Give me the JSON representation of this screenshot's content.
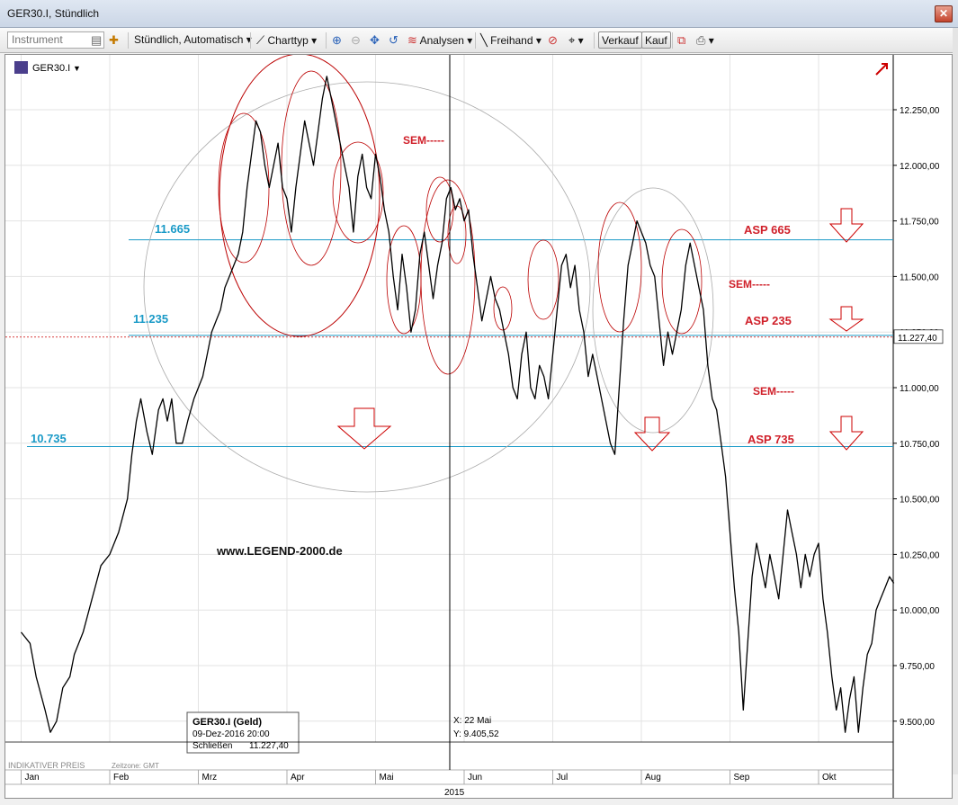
{
  "window": {
    "title": "GER30.I, Stündlich",
    "close_glyph": "✕"
  },
  "toolbar": {
    "instrument_placeholder": "Instrument",
    "timeframe": "Stündlich, Automatisch",
    "charttype": "Charttyp",
    "analysen": "Analysen",
    "freihand": "Freihand",
    "verkauf": "Verkauf",
    "kauf": "Kauf"
  },
  "chart_data": {
    "type": "line",
    "symbol": "GER30.I",
    "year_label": "2015",
    "months": [
      "Jan",
      "Feb",
      "Mrz",
      "Apr",
      "Mai",
      "Jun",
      "Jul",
      "Aug",
      "Sep",
      "Okt"
    ],
    "y_ticks": [
      9500,
      9750,
      10000,
      10250,
      10500,
      10750,
      11000,
      11250,
      11500,
      11750,
      12000,
      12250
    ],
    "y_tick_labels": [
      "9.500,00",
      "9.750,00",
      "10.000,00",
      "10.250,00",
      "10.500,00",
      "10.750,00",
      "11.000,00",
      "11.250,00",
      "11.500,00",
      "11.750,00",
      "12.000,00",
      "12.250,00"
    ],
    "ylim": [
      9340,
      12480
    ],
    "last_price": 11227.4,
    "last_price_label": "11.227,40",
    "crosshair": {
      "x_label": "X: 22 Mai",
      "y_label": "Y: 9.405,52"
    },
    "info_box": {
      "title": "GER30.I (Geld)",
      "date": "09-Dez-2016 20:00",
      "close_label": "Schließen",
      "close_value": "11.227,40"
    },
    "footer_left": "INDIKATIVER PREIS",
    "footer_tz": "Zeitzone: GMT",
    "levels": [
      {
        "value": 11665,
        "label": "11.665"
      },
      {
        "value": 11235,
        "label": "11.235"
      },
      {
        "value": 10735,
        "label": "10.735"
      }
    ],
    "annotations": {
      "watermark": "www.LEGEND-2000.de",
      "asp665": "ASP 665",
      "asp235": "ASP 235",
      "asp735": "ASP 735",
      "sem1": "SEM-----",
      "sem2": "SEM-----",
      "sem3": "SEM-----"
    },
    "series": [
      {
        "values": [
          [
            0.0,
            9900
          ],
          [
            0.1,
            9850
          ],
          [
            0.17,
            9700
          ],
          [
            0.27,
            9550
          ],
          [
            0.33,
            9450
          ],
          [
            0.4,
            9500
          ],
          [
            0.47,
            9650
          ],
          [
            0.55,
            9700
          ],
          [
            0.6,
            9800
          ],
          [
            0.7,
            9900
          ],
          [
            0.8,
            10050
          ],
          [
            0.9,
            10200
          ],
          [
            1.0,
            10250
          ],
          [
            1.1,
            10350
          ],
          [
            1.2,
            10500
          ],
          [
            1.25,
            10700
          ],
          [
            1.3,
            10850
          ],
          [
            1.35,
            10950
          ],
          [
            1.42,
            10800
          ],
          [
            1.48,
            10700
          ],
          [
            1.55,
            10900
          ],
          [
            1.6,
            10950
          ],
          [
            1.65,
            10850
          ],
          [
            1.7,
            10950
          ],
          [
            1.75,
            10750
          ],
          [
            1.82,
            10750
          ],
          [
            1.88,
            10850
          ],
          [
            1.95,
            10950
          ],
          [
            2.0,
            11000
          ],
          [
            2.05,
            11050
          ],
          [
            2.1,
            11150
          ],
          [
            2.15,
            11250
          ],
          [
            2.2,
            11300
          ],
          [
            2.25,
            11350
          ],
          [
            2.3,
            11450
          ],
          [
            2.35,
            11500
          ],
          [
            2.4,
            11550
          ],
          [
            2.45,
            11600
          ],
          [
            2.5,
            11700
          ],
          [
            2.55,
            11900
          ],
          [
            2.6,
            12050
          ],
          [
            2.65,
            12200
          ],
          [
            2.7,
            12150
          ],
          [
            2.75,
            12000
          ],
          [
            2.8,
            11900
          ],
          [
            2.85,
            12000
          ],
          [
            2.9,
            12100
          ],
          [
            2.95,
            11900
          ],
          [
            3.0,
            11850
          ],
          [
            3.05,
            11700
          ],
          [
            3.1,
            11900
          ],
          [
            3.15,
            12050
          ],
          [
            3.2,
            12200
          ],
          [
            3.25,
            12100
          ],
          [
            3.3,
            12000
          ],
          [
            3.35,
            12150
          ],
          [
            3.4,
            12300
          ],
          [
            3.45,
            12400
          ],
          [
            3.5,
            12300
          ],
          [
            3.55,
            12200
          ],
          [
            3.6,
            12100
          ],
          [
            3.65,
            12000
          ],
          [
            3.7,
            11900
          ],
          [
            3.75,
            11700
          ],
          [
            3.8,
            11950
          ],
          [
            3.85,
            12050
          ],
          [
            3.9,
            11900
          ],
          [
            3.95,
            11850
          ],
          [
            4.0,
            12050
          ],
          [
            4.05,
            11950
          ],
          [
            4.1,
            11800
          ],
          [
            4.15,
            11700
          ],
          [
            4.2,
            11500
          ],
          [
            4.25,
            11350
          ],
          [
            4.3,
            11600
          ],
          [
            4.35,
            11450
          ],
          [
            4.4,
            11250
          ],
          [
            4.45,
            11350
          ],
          [
            4.5,
            11600
          ],
          [
            4.55,
            11700
          ],
          [
            4.6,
            11550
          ],
          [
            4.65,
            11400
          ],
          [
            4.7,
            11550
          ],
          [
            4.75,
            11650
          ],
          [
            4.8,
            11850
          ],
          [
            4.85,
            11900
          ],
          [
            4.9,
            11800
          ],
          [
            4.95,
            11850
          ],
          [
            5.0,
            11750
          ],
          [
            5.05,
            11800
          ],
          [
            5.1,
            11600
          ],
          [
            5.15,
            11450
          ],
          [
            5.2,
            11300
          ],
          [
            5.25,
            11400
          ],
          [
            5.3,
            11500
          ],
          [
            5.35,
            11400
          ],
          [
            5.4,
            11350
          ],
          [
            5.45,
            11250
          ],
          [
            5.5,
            11150
          ],
          [
            5.55,
            11000
          ],
          [
            5.6,
            10950
          ],
          [
            5.65,
            11150
          ],
          [
            5.7,
            11250
          ],
          [
            5.75,
            11000
          ],
          [
            5.8,
            10950
          ],
          [
            5.85,
            11100
          ],
          [
            5.9,
            11050
          ],
          [
            5.95,
            10950
          ],
          [
            6.0,
            11150
          ],
          [
            6.05,
            11350
          ],
          [
            6.1,
            11550
          ],
          [
            6.15,
            11600
          ],
          [
            6.2,
            11450
          ],
          [
            6.25,
            11550
          ],
          [
            6.3,
            11350
          ],
          [
            6.35,
            11250
          ],
          [
            6.4,
            11050
          ],
          [
            6.45,
            11150
          ],
          [
            6.5,
            11050
          ],
          [
            6.55,
            10950
          ],
          [
            6.6,
            10850
          ],
          [
            6.65,
            10750
          ],
          [
            6.7,
            10700
          ],
          [
            6.75,
            11000
          ],
          [
            6.8,
            11300
          ],
          [
            6.85,
            11550
          ],
          [
            6.9,
            11650
          ],
          [
            6.95,
            11750
          ],
          [
            7.0,
            11700
          ],
          [
            7.05,
            11650
          ],
          [
            7.1,
            11550
          ],
          [
            7.15,
            11500
          ],
          [
            7.2,
            11300
          ],
          [
            7.25,
            11100
          ],
          [
            7.3,
            11250
          ],
          [
            7.35,
            11150
          ],
          [
            7.4,
            11250
          ],
          [
            7.45,
            11350
          ],
          [
            7.5,
            11550
          ],
          [
            7.55,
            11650
          ],
          [
            7.6,
            11550
          ],
          [
            7.65,
            11450
          ],
          [
            7.7,
            11350
          ],
          [
            7.75,
            11100
          ],
          [
            7.8,
            10950
          ],
          [
            7.85,
            10900
          ],
          [
            7.9,
            10750
          ],
          [
            7.95,
            10600
          ],
          [
            8.0,
            10350
          ],
          [
            8.05,
            10100
          ],
          [
            8.1,
            9900
          ],
          [
            8.15,
            9550
          ],
          [
            8.2,
            9850
          ],
          [
            8.25,
            10150
          ],
          [
            8.3,
            10300
          ],
          [
            8.35,
            10200
          ],
          [
            8.4,
            10100
          ],
          [
            8.45,
            10250
          ],
          [
            8.5,
            10150
          ],
          [
            8.55,
            10050
          ],
          [
            8.6,
            10250
          ],
          [
            8.65,
            10450
          ],
          [
            8.7,
            10350
          ],
          [
            8.75,
            10250
          ],
          [
            8.8,
            10100
          ],
          [
            8.85,
            10250
          ],
          [
            8.9,
            10150
          ],
          [
            8.95,
            10250
          ],
          [
            9.0,
            10300
          ],
          [
            9.05,
            10050
          ],
          [
            9.1,
            9900
          ],
          [
            9.15,
            9700
          ],
          [
            9.2,
            9550
          ],
          [
            9.25,
            9650
          ],
          [
            9.3,
            9450
          ],
          [
            9.35,
            9600
          ],
          [
            9.4,
            9700
          ],
          [
            9.45,
            9450
          ],
          [
            9.5,
            9650
          ],
          [
            9.55,
            9800
          ],
          [
            9.6,
            9850
          ],
          [
            9.65,
            10000
          ],
          [
            9.7,
            10050
          ],
          [
            9.75,
            10100
          ],
          [
            9.8,
            10150
          ],
          [
            9.85,
            10120
          ]
        ]
      }
    ]
  }
}
